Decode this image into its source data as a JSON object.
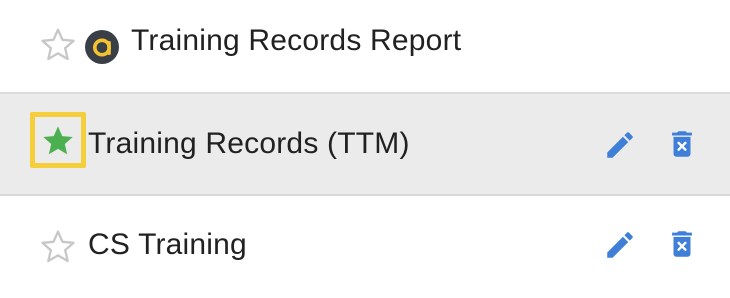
{
  "rows": [
    {
      "label": "Training Records Report",
      "starred": false,
      "star_icon": "star-outline-icon",
      "badge_icon": "a-logo-icon",
      "colors": {
        "star_outline": "#c7c7c7",
        "badge_bg": "#3a3f47",
        "badge_letter": "#f4c430"
      }
    },
    {
      "label": "Training Records (TTM)",
      "starred": true,
      "selected": true,
      "star_icon": "star-filled-icon",
      "edit_icon": "pencil-icon",
      "delete_icon": "trash-icon",
      "colors": {
        "star_fill": "#4caf50",
        "highlight": "#f4cf3b",
        "row_bg": "#ebebeb",
        "action": "#3f7fd8"
      }
    },
    {
      "label": "CS Training",
      "starred": false,
      "star_icon": "star-outline-icon",
      "edit_icon": "pencil-icon",
      "delete_icon": "trash-icon",
      "colors": {
        "star_outline": "#c7c7c7",
        "action": "#3f7fd8"
      }
    }
  ]
}
